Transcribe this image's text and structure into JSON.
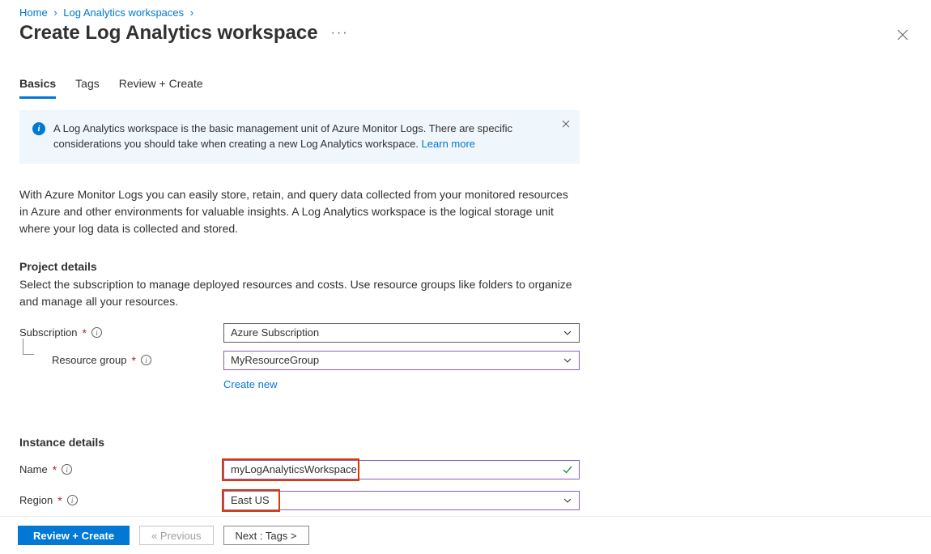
{
  "breadcrumb": {
    "home": "Home",
    "ws": "Log Analytics workspaces"
  },
  "page": {
    "title": "Create Log Analytics workspace"
  },
  "tabs": {
    "basics": "Basics",
    "tags": "Tags",
    "review": "Review + Create"
  },
  "banner": {
    "text": "A Log Analytics workspace is the basic management unit of Azure Monitor Logs. There are specific considerations you should take when creating a new Log Analytics workspace. ",
    "learn": "Learn more"
  },
  "description": "With Azure Monitor Logs you can easily store, retain, and query data collected from your monitored resources in Azure and other environments for valuable insights. A Log Analytics workspace is the logical storage unit where your log data is collected and stored.",
  "project": {
    "heading": "Project details",
    "sub": "Select the subscription to manage deployed resources and costs. Use resource groups like folders to organize and manage all your resources.",
    "sub_label": "Subscription",
    "sub_value": "Azure Subscription",
    "rg_label": "Resource group",
    "rg_value": "MyResourceGroup",
    "create_new": "Create new"
  },
  "instance": {
    "heading": "Instance details",
    "name_label": "Name",
    "name_value": "myLogAnalyticsWorkspace",
    "region_label": "Region",
    "region_value": "East US"
  },
  "footer": {
    "review": "Review + Create",
    "prev": "« Previous",
    "next": "Next : Tags >"
  }
}
